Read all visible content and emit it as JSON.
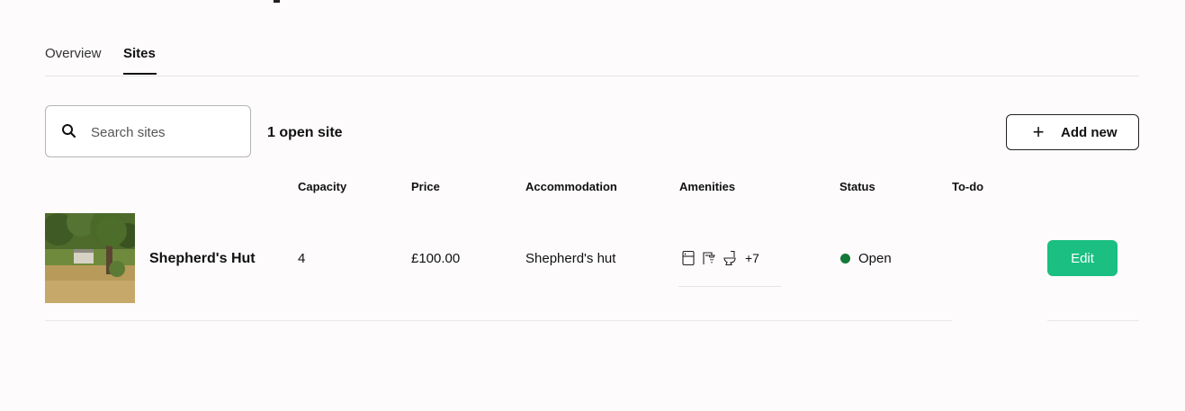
{
  "tabs": [
    {
      "label": "Overview",
      "active": false
    },
    {
      "label": "Sites",
      "active": true
    }
  ],
  "search": {
    "placeholder": "Search sites",
    "value": ""
  },
  "site_count_label": "1 open site",
  "add_button": {
    "label": "Add new"
  },
  "table": {
    "headers": [
      "Capacity",
      "Price",
      "Accommodation",
      "Amenities",
      "Status",
      "To-do"
    ],
    "rows": [
      {
        "name": "Shepherd's Hut",
        "capacity": "4",
        "price": "£100.00",
        "accommodation": "Shepherd's hut",
        "amenities_icons": [
          "fridge-icon",
          "shower-icon",
          "toilet-icon"
        ],
        "amenities_more": "+7",
        "status": "Open",
        "todo": "",
        "edit_label": "Edit"
      }
    ]
  },
  "colors": {
    "status_open": "#137a3a",
    "edit_button": "#1abf81"
  }
}
